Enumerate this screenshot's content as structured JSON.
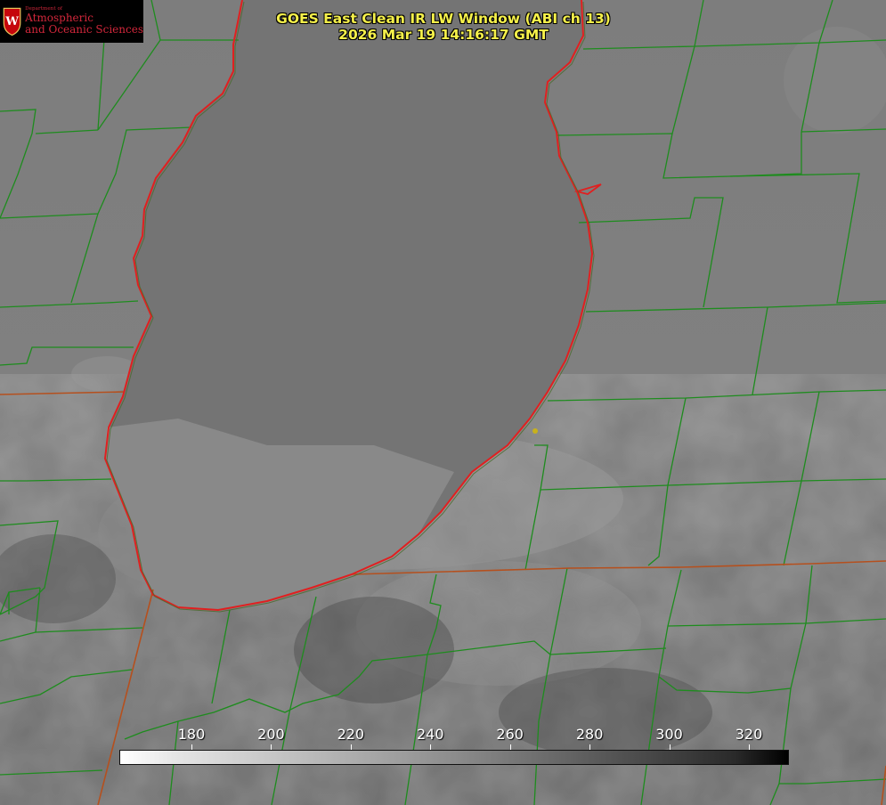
{
  "title": {
    "line1": "GOES East Clean IR LW Window (ABI ch 13)",
    "line2": "2026 Mar 19 14:16:17 GMT"
  },
  "logo": {
    "dept": "Department of",
    "line1": "Atmospheric",
    "line2": "and Oceanic Sciences",
    "crest_letter": "W"
  },
  "colorbar": {
    "ticks": [
      "180",
      "200",
      "220",
      "240",
      "260",
      "280",
      "300",
      "320"
    ],
    "tick_values": [
      180,
      200,
      220,
      240,
      260,
      280,
      300,
      320
    ],
    "colors": {
      "cold": "#ffffff",
      "warm": "#000000"
    }
  },
  "colors": {
    "county_lines": "#1e8c1e",
    "state_lines": "#b5501e",
    "shoreline": "#e02020",
    "title_text": "#f5f04a",
    "site_marker": "#c8b21c"
  }
}
